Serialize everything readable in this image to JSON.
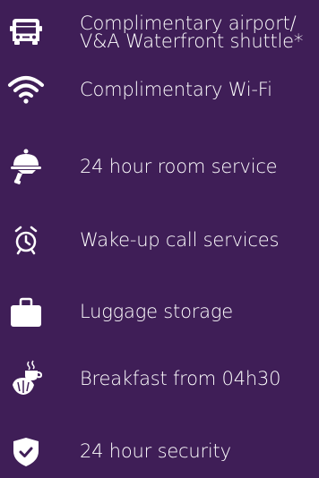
{
  "background_color": "#3f1e57",
  "text_color": "#ffffff",
  "amenities": [
    {
      "icon": "shuttle-bus-icon",
      "lines": [
        "Complimentary airport/",
        "V&A Waterfront shuttle*"
      ]
    },
    {
      "icon": "wifi-icon",
      "lines": [
        "Complimentary Wi-Fi"
      ]
    },
    {
      "icon": "room-service-cloche-icon",
      "lines": [
        "24 hour room service"
      ]
    },
    {
      "icon": "alarm-clock-icon",
      "lines": [
        "Wake-up call services"
      ]
    },
    {
      "icon": "luggage-icon",
      "lines": [
        "Luggage storage"
      ]
    },
    {
      "icon": "breakfast-coffee-croissant-icon",
      "lines": [
        "Breakfast from 04h30"
      ]
    },
    {
      "icon": "security-shield-icon",
      "lines": [
        "24 hour security"
      ]
    }
  ]
}
